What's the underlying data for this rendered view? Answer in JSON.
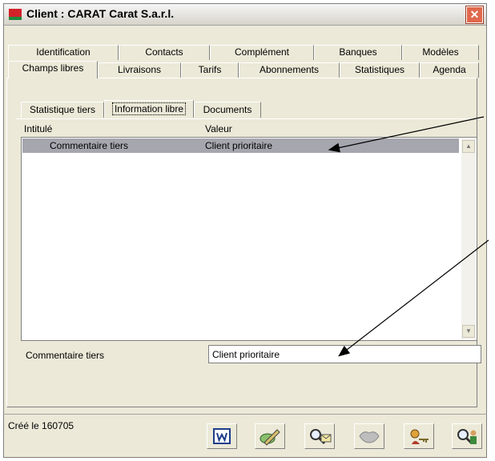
{
  "window": {
    "title": "Client : CARAT Carat S.a.r.l.",
    "close_glyph": "✕"
  },
  "tabs_row1": [
    "Identification",
    "Contacts",
    "Complément",
    "Banques",
    "Modèles"
  ],
  "tabs_row2": [
    "Champs libres",
    "Livraisons",
    "Tarifs",
    "Abonnements",
    "Statistiques",
    "Agenda"
  ],
  "active_tab": "Champs libres",
  "subtabs": [
    "Statistique tiers",
    "Information libre",
    "Documents"
  ],
  "active_subtab": "Information libre",
  "grid": {
    "columns": [
      "Intitulé",
      "Valeur"
    ],
    "rows": [
      {
        "label": "Commentaire tiers",
        "value": "Client prioritaire"
      }
    ]
  },
  "detail": {
    "label": "Commentaire tiers",
    "value": "Client prioritaire"
  },
  "status": {
    "created": "Créé le 160705"
  },
  "toolbar": {
    "buttons": [
      "word-icon",
      "edit-pencil-icon",
      "search-mail-icon",
      "handshake-icon",
      "users-keys-icon",
      "search-user-icon"
    ]
  },
  "colors": {
    "selected_row": "#a6a6ae",
    "window_bg": "#ece9d8",
    "close_button": "#e0684c"
  }
}
